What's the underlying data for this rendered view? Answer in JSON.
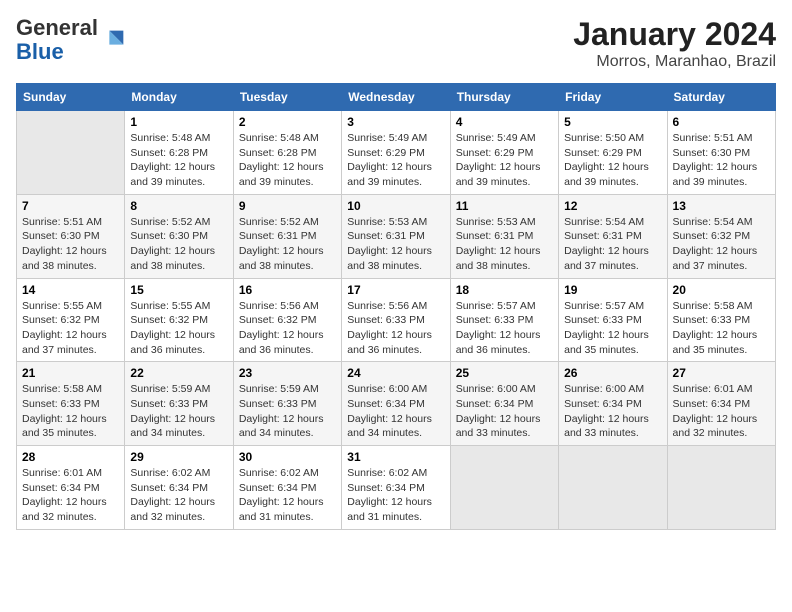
{
  "logo": {
    "general": "General",
    "blue": "Blue"
  },
  "title": "January 2024",
  "subtitle": "Morros, Maranhao, Brazil",
  "headers": [
    "Sunday",
    "Monday",
    "Tuesday",
    "Wednesday",
    "Thursday",
    "Friday",
    "Saturday"
  ],
  "weeks": [
    [
      {
        "day": "",
        "content": ""
      },
      {
        "day": "1",
        "content": "Sunrise: 5:48 AM\nSunset: 6:28 PM\nDaylight: 12 hours\nand 39 minutes."
      },
      {
        "day": "2",
        "content": "Sunrise: 5:48 AM\nSunset: 6:28 PM\nDaylight: 12 hours\nand 39 minutes."
      },
      {
        "day": "3",
        "content": "Sunrise: 5:49 AM\nSunset: 6:29 PM\nDaylight: 12 hours\nand 39 minutes."
      },
      {
        "day": "4",
        "content": "Sunrise: 5:49 AM\nSunset: 6:29 PM\nDaylight: 12 hours\nand 39 minutes."
      },
      {
        "day": "5",
        "content": "Sunrise: 5:50 AM\nSunset: 6:29 PM\nDaylight: 12 hours\nand 39 minutes."
      },
      {
        "day": "6",
        "content": "Sunrise: 5:51 AM\nSunset: 6:30 PM\nDaylight: 12 hours\nand 39 minutes."
      }
    ],
    [
      {
        "day": "7",
        "content": "Sunrise: 5:51 AM\nSunset: 6:30 PM\nDaylight: 12 hours\nand 38 minutes."
      },
      {
        "day": "8",
        "content": "Sunrise: 5:52 AM\nSunset: 6:30 PM\nDaylight: 12 hours\nand 38 minutes."
      },
      {
        "day": "9",
        "content": "Sunrise: 5:52 AM\nSunset: 6:31 PM\nDaylight: 12 hours\nand 38 minutes."
      },
      {
        "day": "10",
        "content": "Sunrise: 5:53 AM\nSunset: 6:31 PM\nDaylight: 12 hours\nand 38 minutes."
      },
      {
        "day": "11",
        "content": "Sunrise: 5:53 AM\nSunset: 6:31 PM\nDaylight: 12 hours\nand 38 minutes."
      },
      {
        "day": "12",
        "content": "Sunrise: 5:54 AM\nSunset: 6:31 PM\nDaylight: 12 hours\nand 37 minutes."
      },
      {
        "day": "13",
        "content": "Sunrise: 5:54 AM\nSunset: 6:32 PM\nDaylight: 12 hours\nand 37 minutes."
      }
    ],
    [
      {
        "day": "14",
        "content": "Sunrise: 5:55 AM\nSunset: 6:32 PM\nDaylight: 12 hours\nand 37 minutes."
      },
      {
        "day": "15",
        "content": "Sunrise: 5:55 AM\nSunset: 6:32 PM\nDaylight: 12 hours\nand 36 minutes."
      },
      {
        "day": "16",
        "content": "Sunrise: 5:56 AM\nSunset: 6:32 PM\nDaylight: 12 hours\nand 36 minutes."
      },
      {
        "day": "17",
        "content": "Sunrise: 5:56 AM\nSunset: 6:33 PM\nDaylight: 12 hours\nand 36 minutes."
      },
      {
        "day": "18",
        "content": "Sunrise: 5:57 AM\nSunset: 6:33 PM\nDaylight: 12 hours\nand 36 minutes."
      },
      {
        "day": "19",
        "content": "Sunrise: 5:57 AM\nSunset: 6:33 PM\nDaylight: 12 hours\nand 35 minutes."
      },
      {
        "day": "20",
        "content": "Sunrise: 5:58 AM\nSunset: 6:33 PM\nDaylight: 12 hours\nand 35 minutes."
      }
    ],
    [
      {
        "day": "21",
        "content": "Sunrise: 5:58 AM\nSunset: 6:33 PM\nDaylight: 12 hours\nand 35 minutes."
      },
      {
        "day": "22",
        "content": "Sunrise: 5:59 AM\nSunset: 6:33 PM\nDaylight: 12 hours\nand 34 minutes."
      },
      {
        "day": "23",
        "content": "Sunrise: 5:59 AM\nSunset: 6:33 PM\nDaylight: 12 hours\nand 34 minutes."
      },
      {
        "day": "24",
        "content": "Sunrise: 6:00 AM\nSunset: 6:34 PM\nDaylight: 12 hours\nand 34 minutes."
      },
      {
        "day": "25",
        "content": "Sunrise: 6:00 AM\nSunset: 6:34 PM\nDaylight: 12 hours\nand 33 minutes."
      },
      {
        "day": "26",
        "content": "Sunrise: 6:00 AM\nSunset: 6:34 PM\nDaylight: 12 hours\nand 33 minutes."
      },
      {
        "day": "27",
        "content": "Sunrise: 6:01 AM\nSunset: 6:34 PM\nDaylight: 12 hours\nand 32 minutes."
      }
    ],
    [
      {
        "day": "28",
        "content": "Sunrise: 6:01 AM\nSunset: 6:34 PM\nDaylight: 12 hours\nand 32 minutes."
      },
      {
        "day": "29",
        "content": "Sunrise: 6:02 AM\nSunset: 6:34 PM\nDaylight: 12 hours\nand 32 minutes."
      },
      {
        "day": "30",
        "content": "Sunrise: 6:02 AM\nSunset: 6:34 PM\nDaylight: 12 hours\nand 31 minutes."
      },
      {
        "day": "31",
        "content": "Sunrise: 6:02 AM\nSunset: 6:34 PM\nDaylight: 12 hours\nand 31 minutes."
      },
      {
        "day": "",
        "content": ""
      },
      {
        "day": "",
        "content": ""
      },
      {
        "day": "",
        "content": ""
      }
    ]
  ]
}
